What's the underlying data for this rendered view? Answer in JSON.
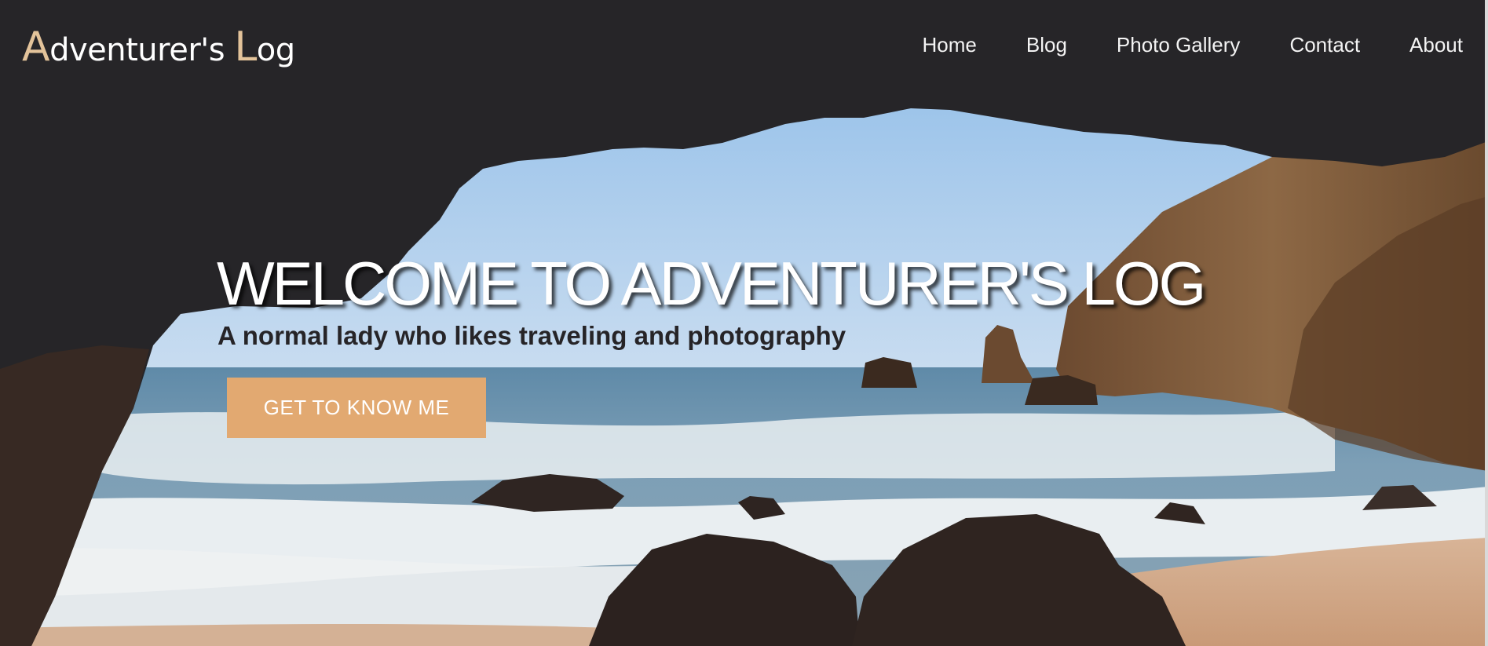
{
  "site": {
    "logo_first_cap": "A",
    "logo_first_rest": "dventurer's ",
    "logo_second_cap": "L",
    "logo_second_rest": "og"
  },
  "nav": {
    "items": [
      {
        "label": "Home"
      },
      {
        "label": "Blog"
      },
      {
        "label": "Photo Gallery"
      },
      {
        "label": "Contact"
      },
      {
        "label": "About"
      }
    ]
  },
  "hero": {
    "title": "WELCOME TO ADVENTURER'S LOG",
    "subtitle": "A normal lady who likes traveling and photography",
    "cta_label": "GET TO KNOW ME",
    "background_image": "sea cave opening onto a rocky beach with waves",
    "colors": {
      "accent": "#e2a971",
      "logo_accent": "#e3c39a",
      "dark": "#262528"
    }
  }
}
